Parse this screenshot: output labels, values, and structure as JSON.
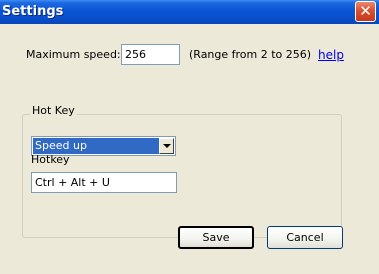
{
  "window": {
    "title": "Settings",
    "close_glyph": "✕"
  },
  "max_speed": {
    "label": "Maximum speed:",
    "value": "256",
    "range_note": "(Range from 2 to 256)"
  },
  "help_link": "help",
  "hotkey_group": {
    "legend": "Hot Key",
    "action_selected": "Speed up",
    "hotkey_label": "Hotkey",
    "hotkey_value": "Ctrl + Alt + U"
  },
  "buttons": {
    "save": "Save",
    "cancel": "Cancel"
  },
  "colors": {
    "title_bar": "#0A55D5",
    "window_face": "#ECE9D8",
    "selection": "#316AC5",
    "link": "#0000EE"
  },
  "icons": {
    "close": "close-icon",
    "dropdown": "chevron-down-icon"
  }
}
